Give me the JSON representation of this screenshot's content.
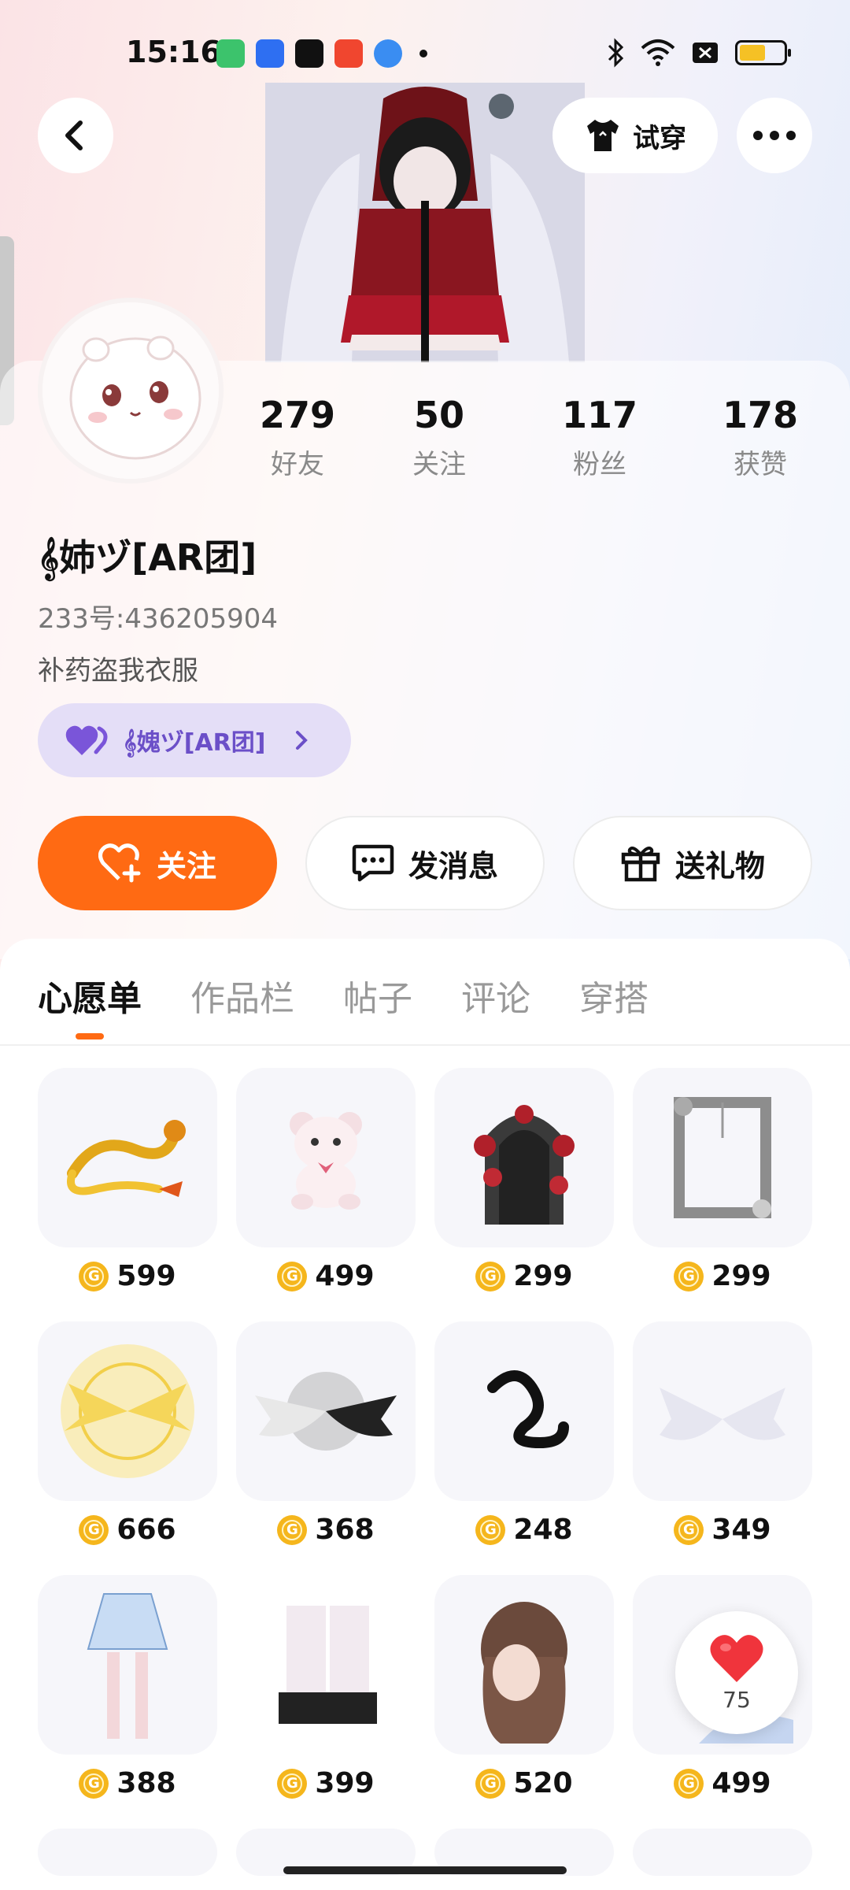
{
  "status_bar": {
    "time": "15:16"
  },
  "header": {
    "tryon_label": "试穿"
  },
  "stats": [
    {
      "num": "279",
      "label": "好友"
    },
    {
      "num": "50",
      "label": "关注"
    },
    {
      "num": "117",
      "label": "粉丝"
    },
    {
      "num": "178",
      "label": "获赞"
    }
  ],
  "profile": {
    "nickname": "𝄞姉ヅ[AR团]",
    "uid": "233号:436205904",
    "bio": "补药盗我衣服",
    "cp_name": "𝄞媿ヅ[AR团]"
  },
  "actions": {
    "follow": "关注",
    "message": "发消息",
    "gift": "送礼物"
  },
  "tabs": [
    "心愿单",
    "作品栏",
    "帖子",
    "评论",
    "穿搭"
  ],
  "wishlist": [
    {
      "icon": "golden-dragon",
      "price": "599"
    },
    {
      "icon": "pink-teddy-bear",
      "price": "499"
    },
    {
      "icon": "rose-gothic-door",
      "price": "299"
    },
    {
      "icon": "silver-ornate-frame",
      "price": "299"
    },
    {
      "icon": "golden-wings-halo",
      "price": "666"
    },
    {
      "icon": "black-white-wings",
      "price": "368"
    },
    {
      "icon": "black-tail",
      "price": "248"
    },
    {
      "icon": "white-angel-wings",
      "price": "349"
    },
    {
      "icon": "blue-skirt-stockings",
      "price": "388"
    },
    {
      "icon": "white-boots",
      "price": "399"
    },
    {
      "icon": "brown-long-hair",
      "price": "520"
    },
    {
      "icon": "blue-hair-item",
      "price": "499"
    }
  ],
  "coin_glyph": "G",
  "like_float": {
    "count": "75"
  },
  "colors": {
    "accent": "#ff6a13",
    "coin": "#f5b61c",
    "cp_purple": "#6b4fc8"
  }
}
